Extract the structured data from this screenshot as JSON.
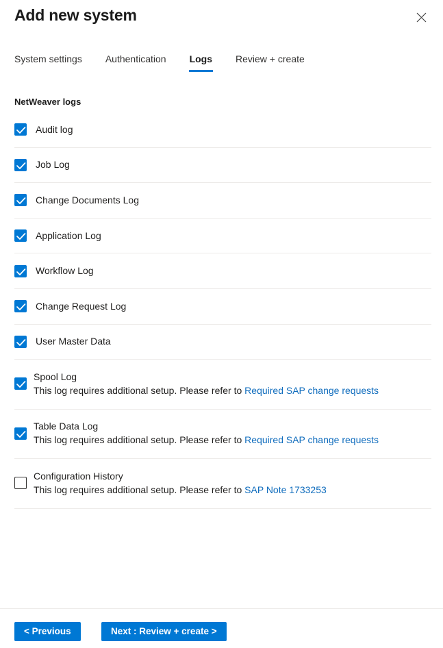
{
  "header": {
    "title": "Add new system",
    "close_icon": "close-icon"
  },
  "tabs": [
    {
      "label": "System settings",
      "selected": false
    },
    {
      "label": "Authentication",
      "selected": false
    },
    {
      "label": "Logs",
      "selected": true
    },
    {
      "label": "Review + create",
      "selected": false
    }
  ],
  "section": {
    "title": "NetWeaver logs"
  },
  "logs": [
    {
      "label": "Audit log",
      "checked": true,
      "description": null,
      "link": null
    },
    {
      "label": "Job Log",
      "checked": true,
      "description": null,
      "link": null
    },
    {
      "label": "Change Documents Log",
      "checked": true,
      "description": null,
      "link": null
    },
    {
      "label": "Application Log",
      "checked": true,
      "description": null,
      "link": null
    },
    {
      "label": "Workflow Log",
      "checked": true,
      "description": null,
      "link": null
    },
    {
      "label": "Change Request Log",
      "checked": true,
      "description": null,
      "link": null
    },
    {
      "label": "User Master Data",
      "checked": true,
      "description": null,
      "link": null
    },
    {
      "label": "Spool Log",
      "checked": true,
      "description": "This log requires additional setup. Please refer to ",
      "link": "Required SAP change requests"
    },
    {
      "label": "Table Data Log",
      "checked": true,
      "description": "This log requires additional setup. Please refer to ",
      "link": "Required SAP change requests"
    },
    {
      "label": "Configuration History",
      "checked": false,
      "description": "This log requires additional setup. Please refer to ",
      "link": "SAP Note 1733253"
    }
  ],
  "footer": {
    "previous_label": "< Previous",
    "next_label": "Next : Review + create >"
  },
  "colors": {
    "accent": "#0078d4",
    "link": "#0f6cbd",
    "divider": "#edebe9",
    "text": "#201f1e"
  }
}
